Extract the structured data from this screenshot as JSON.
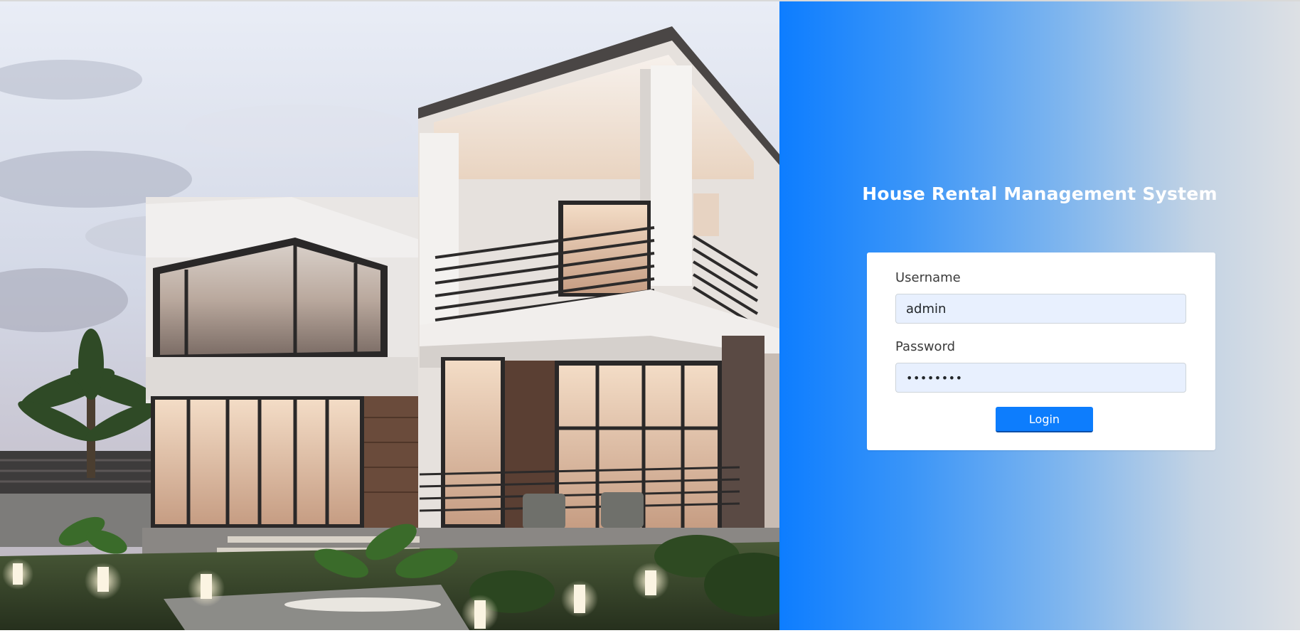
{
  "app": {
    "title": "House Rental Management System"
  },
  "login_form": {
    "username_label": "Username",
    "username_value": "admin",
    "password_label": "Password",
    "password_value": "admin123",
    "login_button_label": "Login"
  },
  "colors": {
    "panel_gradient_start": "#0d7dff",
    "panel_gradient_end": "#dde0e4",
    "button": "#0d7dfd",
    "input_background": "#e8f0fe"
  }
}
